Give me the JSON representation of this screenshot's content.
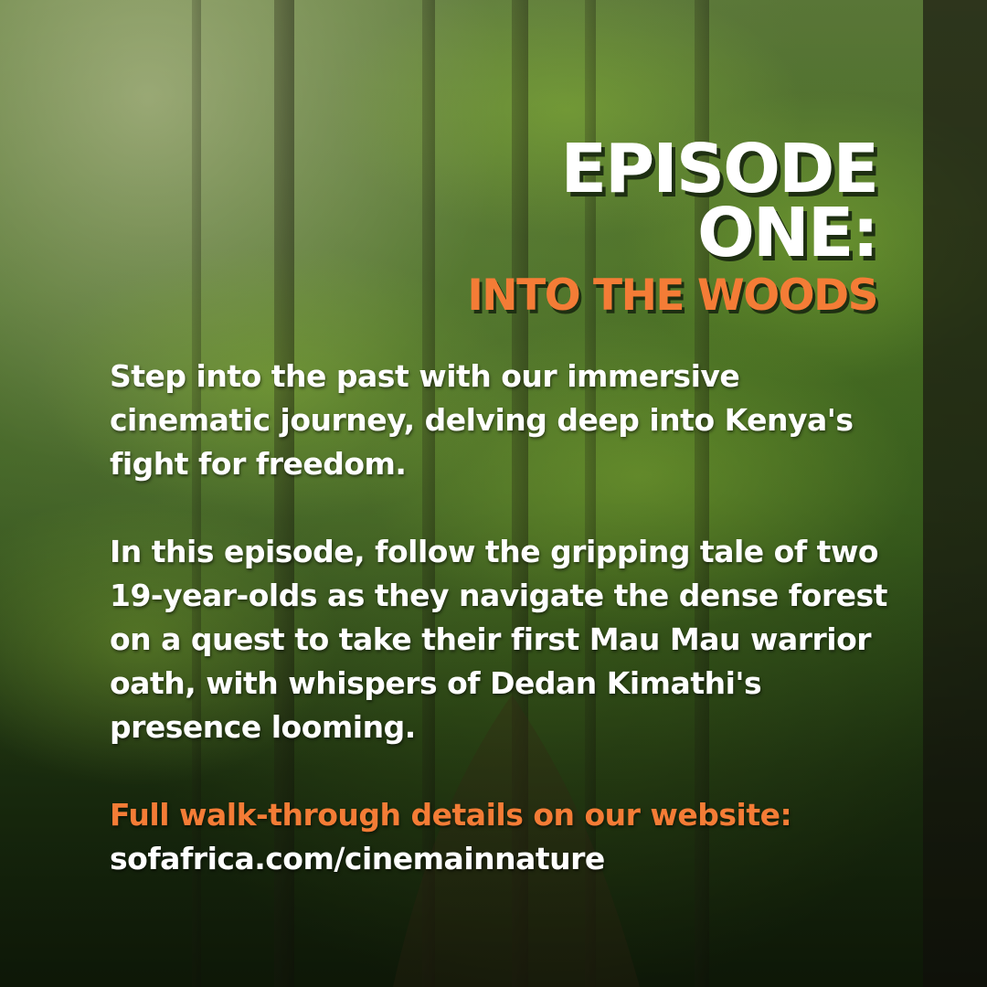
{
  "title": {
    "line1": "EPISODE",
    "line2": "ONE:",
    "subtitle": "INTO THE WOODS"
  },
  "body": {
    "paragraph1": "Step into the past with our immersive cinematic journey, delving deep into Kenya's fight for freedom.",
    "paragraph2": "In this episode, follow the gripping tale of two 19-year-olds as they navigate the dense forest on a quest to take their first Mau Mau warrior oath, with whispers of Dedan Kimathi's presence looming."
  },
  "cta": {
    "label": "Full walk-through details on our website:",
    "url": "sofafrica.com/cinemainnature"
  },
  "colors": {
    "accent": "#f47c36",
    "text": "#ffffff",
    "forest": "#3d6620"
  }
}
